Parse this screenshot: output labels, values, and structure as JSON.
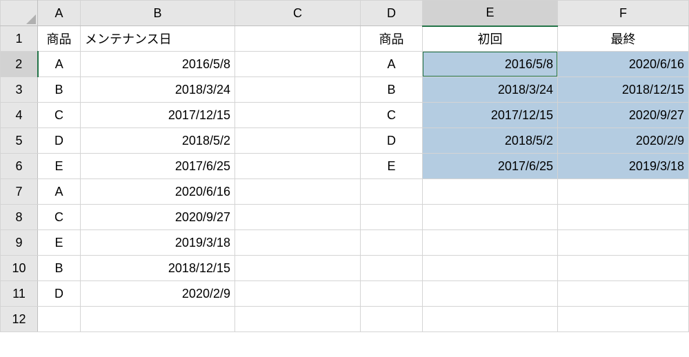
{
  "colHeaders": [
    "A",
    "B",
    "C",
    "D",
    "E",
    "F"
  ],
  "rowHeaders": [
    "1",
    "2",
    "3",
    "4",
    "5",
    "6",
    "7",
    "8",
    "9",
    "10",
    "11",
    "12"
  ],
  "selectedCol": "E",
  "selectedRow": "2",
  "header": {
    "A": "商品",
    "B": "メンテナンス日",
    "D": "商品",
    "E": "初回",
    "F": "最終"
  },
  "leftTable": [
    {
      "product": "A",
      "date": "2016/5/8"
    },
    {
      "product": "B",
      "date": "2018/3/24"
    },
    {
      "product": "C",
      "date": "2017/12/15"
    },
    {
      "product": "D",
      "date": "2018/5/2"
    },
    {
      "product": "E",
      "date": "2017/6/25"
    },
    {
      "product": "A",
      "date": "2020/6/16"
    },
    {
      "product": "C",
      "date": "2020/9/27"
    },
    {
      "product": "E",
      "date": "2019/3/18"
    },
    {
      "product": "B",
      "date": "2018/12/15"
    },
    {
      "product": "D",
      "date": "2020/2/9"
    }
  ],
  "rightTable": [
    {
      "product": "A",
      "first": "2016/5/8",
      "last": "2020/6/16"
    },
    {
      "product": "B",
      "first": "2018/3/24",
      "last": "2018/12/15"
    },
    {
      "product": "C",
      "first": "2017/12/15",
      "last": "2020/9/27"
    },
    {
      "product": "D",
      "first": "2018/5/2",
      "last": "2020/2/9"
    },
    {
      "product": "E",
      "first": "2017/6/25",
      "last": "2019/3/18"
    }
  ]
}
